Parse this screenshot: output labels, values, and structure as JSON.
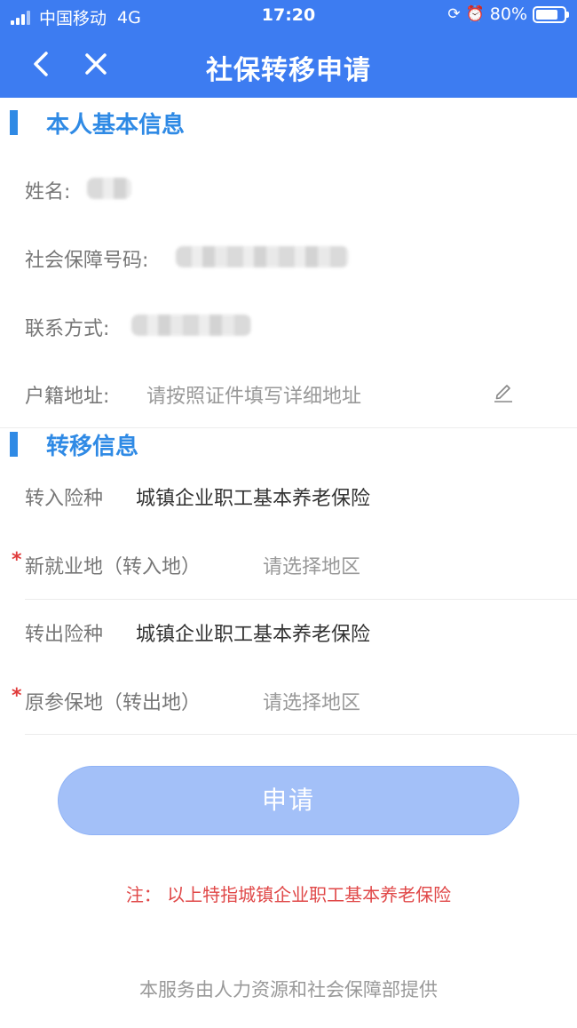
{
  "status_bar": {
    "carrier": "中国移动",
    "network": "4G",
    "time": "17:20",
    "battery": "80%",
    "battery_level": 0.8
  },
  "nav": {
    "title": "社保转移申请"
  },
  "personal": {
    "section_title": "本人基本信息",
    "name_label": "姓名:",
    "ssn_label": "社会保障号码:",
    "contact_label": "联系方式:",
    "address_label": "户籍地址:",
    "address_placeholder": "请按照证件填写详细地址"
  },
  "transfer": {
    "section_title": "转移信息",
    "in_type_label": "转入险种",
    "in_type_value": "城镇企业职工基本养老保险",
    "new_place_label": "新就业地（转入地）",
    "new_place_placeholder": "请选择地区",
    "out_type_label": "转出险种",
    "out_type_value": "城镇企业职工基本养老保险",
    "orig_place_label": "原参保地（转出地）",
    "orig_place_placeholder": "请选择地区",
    "required_mark": "*"
  },
  "apply_button": "申请",
  "note": "注：  以上特指城镇企业职工基本养老保险",
  "footer": "本服务由人力资源和社会保障部提供",
  "colors": {
    "header_bg": "#3d7cf1",
    "section_accent": "#2f8ae5",
    "button_bg": "#a3c0f8",
    "note_red": "#e04848"
  }
}
